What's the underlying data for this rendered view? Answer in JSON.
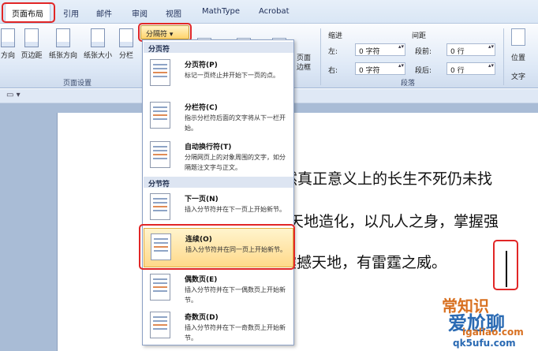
{
  "tabs": [
    "页面布局",
    "引用",
    "邮件",
    "审阅",
    "视图",
    "MathType",
    "Acrobat"
  ],
  "ribbon": {
    "buttons": [
      "方向",
      "页边距",
      "纸张方向",
      "纸张大小",
      "分栏"
    ],
    "page_setup_label": "页面设置",
    "breaks_button": "分隔符",
    "page_border": "页面\n边框",
    "indent_label": "缩进",
    "indent_left_label": "左:",
    "indent_left_value": "0 字符",
    "indent_right_label": "右:",
    "indent_right_value": "0 字符",
    "spacing_label": "间距",
    "spacing_before_label": "段前:",
    "spacing_before_value": "0 行",
    "spacing_after_label": "段后:",
    "spacing_after_value": "0 行",
    "paragraph_label": "段落",
    "position_label": "位置",
    "wrap_label": "文字"
  },
  "menu": {
    "page_breaks_section": "分页符",
    "section_breaks_section": "分节符",
    "items": [
      {
        "title": "分页符(P)",
        "desc": "标记一页终止并开始下一页的点。"
      },
      {
        "title": "分栏符(C)",
        "desc": "指示分栏符后面的文字将从下一栏开始。"
      },
      {
        "title": "自动换行符(T)",
        "desc": "分隔网页上的对象周围的文字，如分隔题注文字与正文。"
      },
      {
        "title": "下一页(N)",
        "desc": "插入分节符并在下一页上开始新节。"
      },
      {
        "title": "连续(O)",
        "desc": "插入分节符并在同一页上开始新节。"
      },
      {
        "title": "偶数页(E)",
        "desc": "插入分节符并在下一偶数页上开始新节。"
      },
      {
        "title": "奇数页(D)",
        "desc": "插入分节符并在下一奇数页上开始新节。"
      }
    ]
  },
  "document": {
    "lines": [
      "然真正意义上的长生不死仍未找",
      "天地造化，以凡人之身，掌握强",
      "可震撼天地，有雷霆之威。"
    ]
  },
  "watermark": {
    "brand": "爱尬聊",
    "url": "igaliao.com",
    "url2": "qk5ufu.com",
    "mid": "常知识"
  },
  "colors": {
    "highlight_red": "#e12626",
    "menu_highlight": "#ffd98a"
  }
}
